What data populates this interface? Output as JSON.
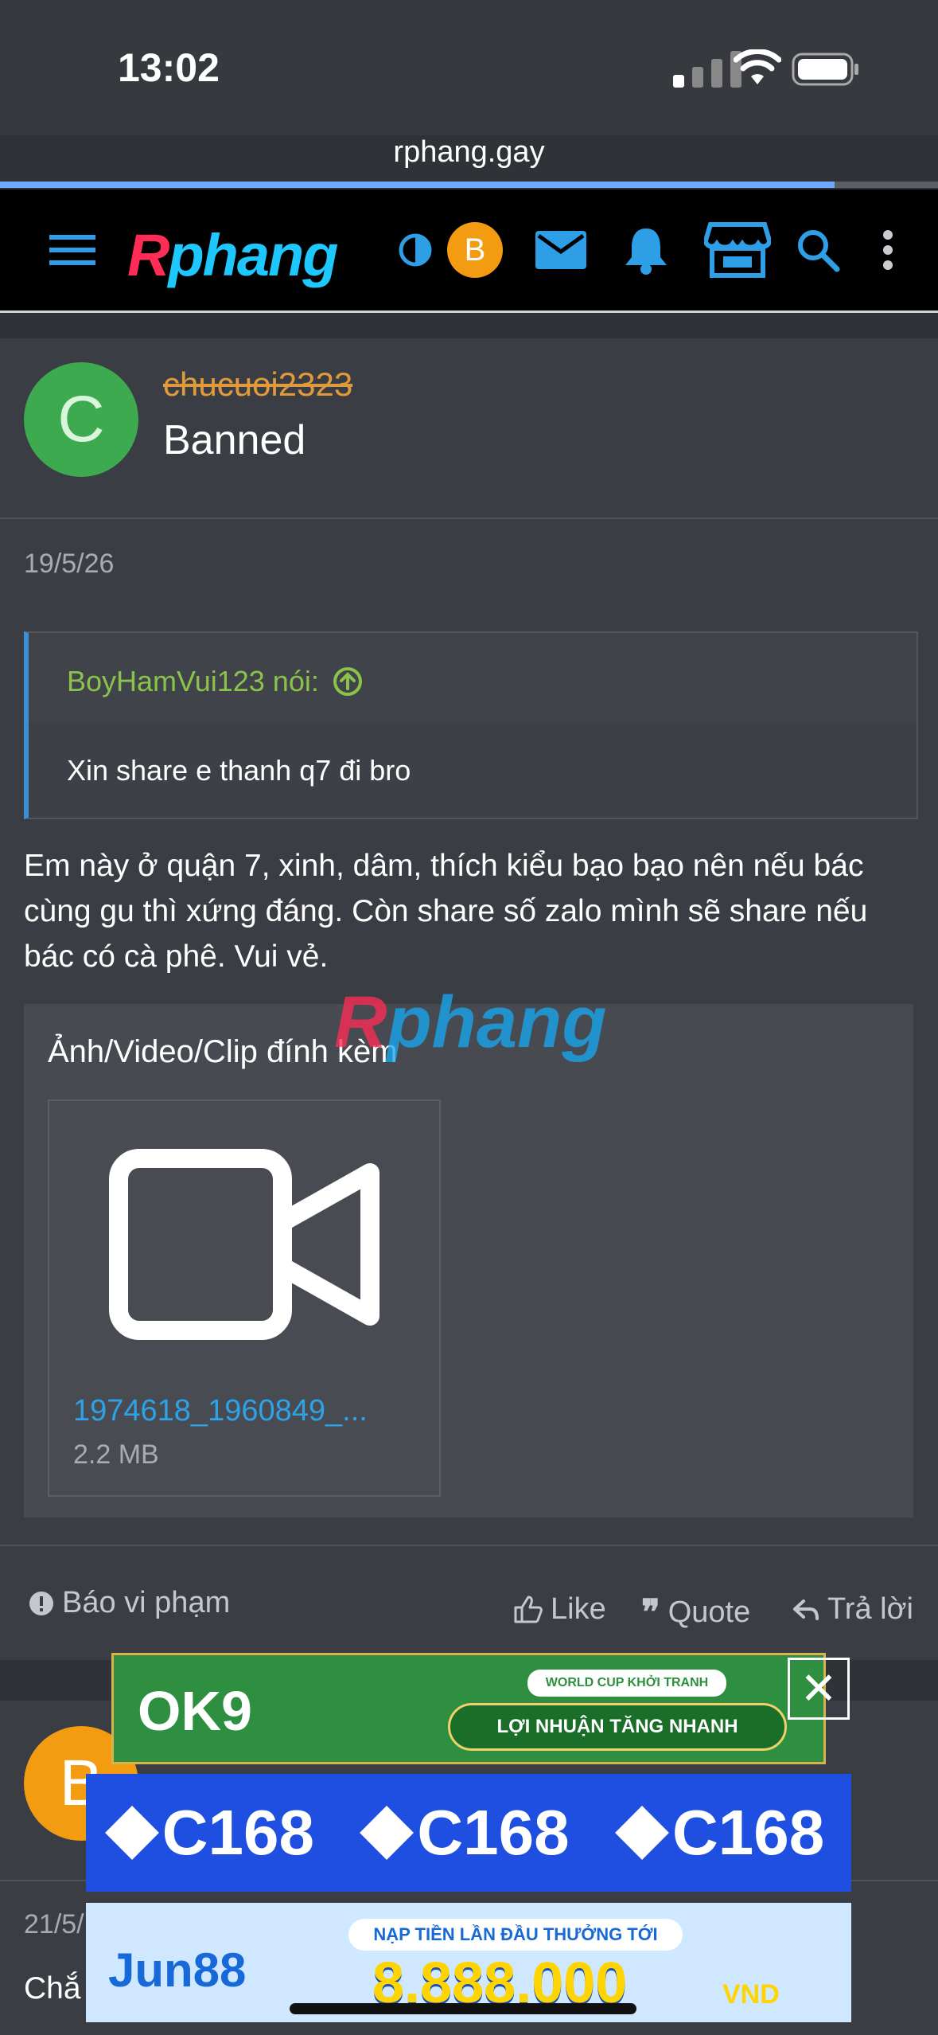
{
  "status_bar": {
    "time": "13:02",
    "url": "rphang.gay",
    "load_progress": 0.89
  },
  "nav": {
    "logo_text": "Rphang",
    "avatar_letter": "B",
    "icons": [
      "menu-icon",
      "theme-toggle-icon",
      "mail-icon",
      "bell-icon",
      "store-icon",
      "search-icon",
      "more-icon"
    ]
  },
  "post": {
    "avatar_letter": "C",
    "username": "chucuoi2323",
    "user_title": "Banned",
    "date": "19/5/26",
    "quote": {
      "author_label": "BoyHamVui123 nói:",
      "text": "Xin share e thanh q7 đi bro"
    },
    "body": "Em này ở quận 7, xinh, dâm, thích kiểu bạo bạo nên nếu bác cùng gu thì xứng đáng. Còn share số zalo mình sẽ share nếu bác có cà phê. Vui vẻ.",
    "attachments": {
      "title": "Ảnh/Video/Clip đính kèm",
      "items": [
        {
          "name": "1974618_1960849_...",
          "size": "2.2 MB"
        }
      ]
    },
    "actions": {
      "report": "Báo vi phạm",
      "like": "Like",
      "quote": "Quote",
      "reply": "Trả lời"
    },
    "watermark": "Rphang"
  },
  "post2": {
    "avatar_letter": "B",
    "date": "21/5/",
    "text": "Chắ"
  },
  "ads": {
    "ok9": {
      "brand": "OK9",
      "tag": "WORLD CUP KHỞI TRANH",
      "cta": "LỢI NHUẬN TĂNG NHANH"
    },
    "c168": {
      "brand": "C168"
    },
    "jun88": {
      "brand": "Jun88",
      "headline": "NẠP TIỀN LẦN ĐẦU THƯỞNG TỚI",
      "amount": "8.888.000",
      "currency": "VND"
    }
  }
}
